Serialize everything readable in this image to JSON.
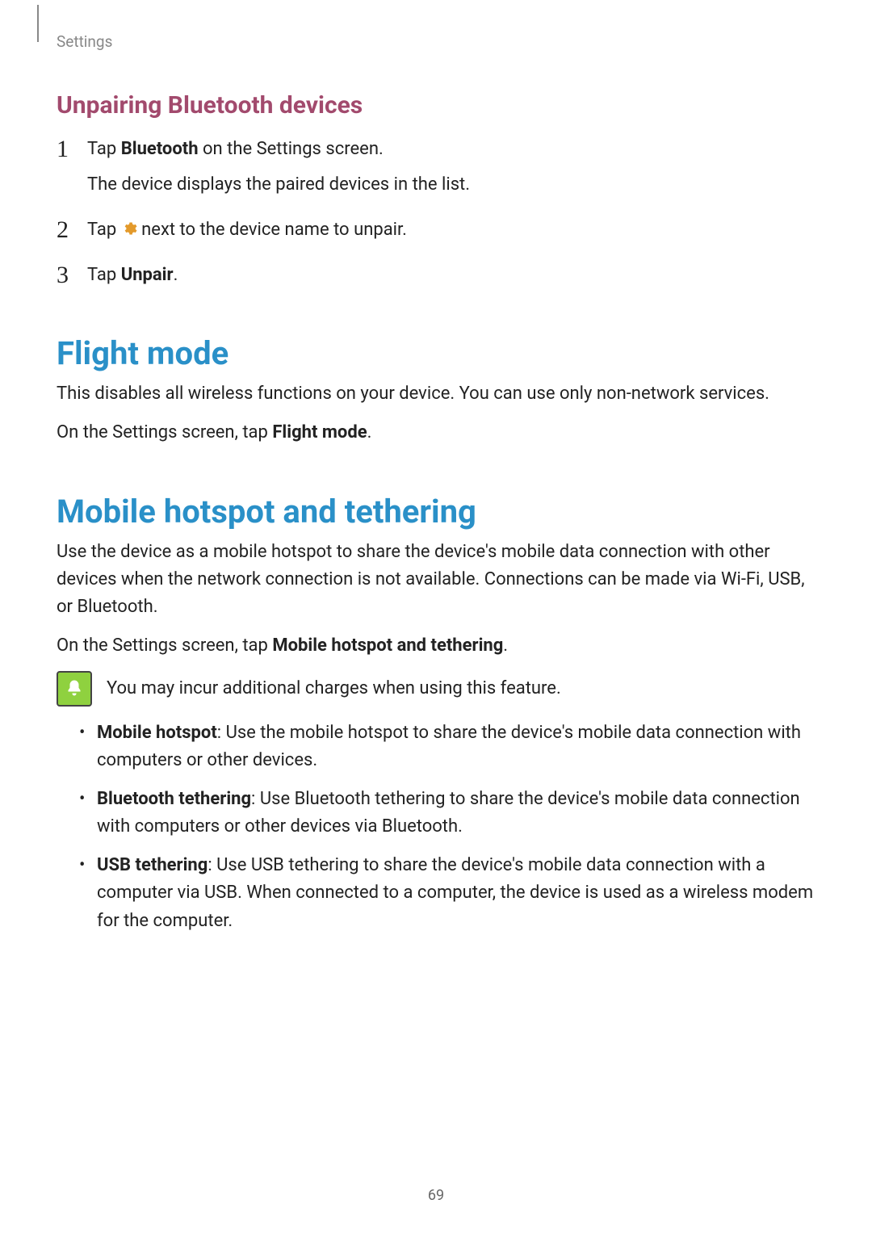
{
  "header": {
    "label": "Settings"
  },
  "unpairing": {
    "heading": "Unpairing Bluetooth devices",
    "step1_pre": "Tap ",
    "step1_bold": "Bluetooth",
    "step1_post": " on the Settings screen.",
    "step1_sub": "The device displays the paired devices in the list.",
    "step2_pre": "Tap ",
    "step2_post": " next to the device name to unpair.",
    "step3_pre": "Tap ",
    "step3_bold": "Unpair",
    "step3_post": "."
  },
  "flight": {
    "heading": "Flight mode",
    "p1": "This disables all wireless functions on your device. You can use only non-network services.",
    "p2_pre": "On the Settings screen, tap ",
    "p2_bold": "Flight mode",
    "p2_post": "."
  },
  "hotspot": {
    "heading": "Mobile hotspot and tethering",
    "p1": "Use the device as a mobile hotspot to share the device's mobile data connection with other devices when the network connection is not available. Connections can be made via Wi-Fi, USB, or Bluetooth.",
    "p2_pre": "On the Settings screen, tap ",
    "p2_bold": "Mobile hotspot and tethering",
    "p2_post": ".",
    "note": "You may incur additional charges when using this feature.",
    "b1_bold": "Mobile hotspot",
    "b1_rest": ": Use the mobile hotspot to share the device's mobile data connection with computers or other devices.",
    "b2_bold": "Bluetooth tethering",
    "b2_rest": ": Use Bluetooth tethering to share the device's mobile data connection with computers or other devices via Bluetooth.",
    "b3_bold": "USB tethering",
    "b3_rest": ": Use USB tethering to share the device's mobile data connection with a computer via USB. When connected to a computer, the device is used as a wireless modem for the computer."
  },
  "page_number": "69"
}
